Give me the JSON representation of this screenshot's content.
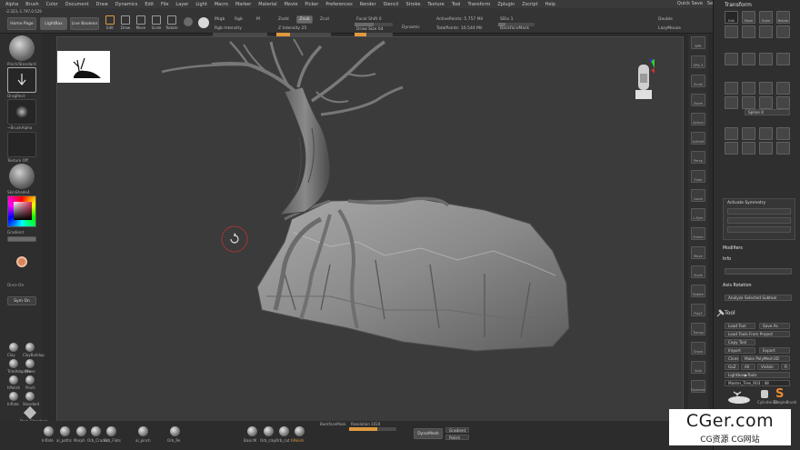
{
  "menu": {
    "items": [
      "Alpha",
      "Brush",
      "Color",
      "Document",
      "Draw",
      "Dynamics",
      "Edit",
      "File",
      "Layer",
      "Light",
      "Macro",
      "Marker",
      "Material",
      "Movie",
      "Picker",
      "Preferences",
      "Render",
      "Stencil",
      "Stroke",
      "Texture",
      "Tool",
      "Transform",
      "Zplugin",
      "Zscript",
      "Help"
    ],
    "right": [
      "Quick Save",
      "See-through 0",
      "Menus",
      "DefaultZScript"
    ]
  },
  "shelf": {
    "coords": "-2.323,-1.797,0.529",
    "home_page": "Home Page",
    "lightbox": "LightBox",
    "live_boolean": "Live Boolean",
    "tools": [
      "Edit",
      "Draw",
      "Move",
      "Scale",
      "Rotate"
    ],
    "mrgb": "Mrgb",
    "rgb": "Rgb",
    "m": "M",
    "rgb_intensity": "Rgb Intensity",
    "zadd": "Zadd",
    "zsub": "Zsub",
    "zcut": "Zcut",
    "z_intensity": "Z Intensity 25",
    "focal_shift": "Focal Shift 0",
    "draw_size": "Draw Size 64",
    "dynamic": "Dynamic",
    "active_points": "ActivePoints: 5.757 Mil",
    "total_points": "TotalPoints: 16.544 Mil",
    "sdiv": "SDiv 1",
    "backface_mask": "BackfaceMask",
    "double": "Double",
    "lazymouse": "LazyMouse"
  },
  "left_tray": {
    "brush_label": "Pinch/Standard",
    "stroke_label": "DragRect",
    "alpha_label": "~BrushAlpha",
    "texture_label": "Texture Off",
    "material_label": "SkinShade4",
    "gradient_label": "Gradient",
    "switch_color": "SwitchColor",
    "alternate": "Alternate",
    "draw_mode": "Once On",
    "sym_btn": "Sym On",
    "brush_names": [
      "Clay",
      "ClayBuildup",
      "TrimAdaptive",
      "Move",
      "hPolish",
      "Pinch",
      "Inflate",
      "Standard",
      "Dam_Standard"
    ]
  },
  "right_shelf": [
    "BPR",
    "SPix 3",
    "Scroll",
    "Zoom",
    "Actual",
    "AAHalf",
    "Persp",
    "Floor",
    "Local",
    "L.Sym",
    "Frame",
    "Move",
    "Scale",
    "Rotate",
    "PolyF",
    "Transp",
    "Ghost",
    "Solo",
    "Dynamic"
  ],
  "right_panel": {
    "transform_title": "Transform",
    "tool_title": "Tool",
    "activate_symmetry": "Activate Symmetry",
    "modifiers": "Modifiers",
    "info": "Info",
    "rotation_label": "Axis Rotation",
    "analyze": "Analyze Selected Subtool",
    "tool_buttons": [
      "Load Tool",
      "Save As",
      "Load Tools From Project",
      "Copy Tool",
      "Import",
      "Export",
      "Clone",
      "Make PolyMesh3D",
      "GoZ",
      "All",
      "Visible",
      "R",
      "Lightbox▶Tools"
    ],
    "tool_name": "Master_Tree_R03 : 48",
    "subtool_names": [
      "Cylinder3D",
      "SimpleBrush"
    ],
    "grid_labels": [
      "Edit",
      "Move",
      "Scale",
      "Rotate"
    ],
    "spline_value": "Spline 0"
  },
  "bottom": {
    "brushes": [
      "Inflate",
      "ai_pathz",
      "Morph",
      "Orb_Cracks",
      "Orb_Flats",
      "ai_pinch",
      "Orb_Re",
      "BasicM",
      "Orb_clay",
      "Orb_cut",
      "hPolish"
    ],
    "backface": "BackfaceMask",
    "resolution": "Resolution 1024",
    "dynamesh": "DynaMesh",
    "gradient": "Gradient",
    "polish": "Polish"
  },
  "watermark": {
    "main": "CGer.com",
    "sub": "CG资源 CG网站"
  }
}
